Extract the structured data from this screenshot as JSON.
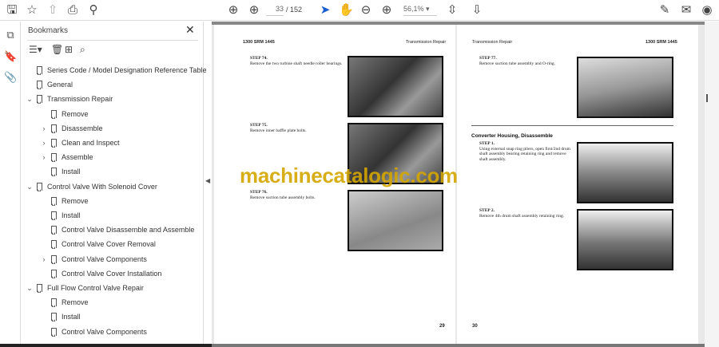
{
  "toolbar": {
    "page_current": "33",
    "page_total": "/ 152",
    "zoom": "56,1%"
  },
  "bookmarks": {
    "title": "Bookmarks",
    "items": [
      {
        "label": "Series Code / Model Designation Reference Table",
        "level": 0,
        "expander": ""
      },
      {
        "label": "General",
        "level": 0,
        "expander": ""
      },
      {
        "label": "Transmission Repair",
        "level": 0,
        "expander": "open"
      },
      {
        "label": "Remove",
        "level": 1,
        "expander": ""
      },
      {
        "label": "Disassemble",
        "level": 1,
        "expander": "closed"
      },
      {
        "label": "Clean and Inspect",
        "level": 1,
        "expander": "closed"
      },
      {
        "label": "Assemble",
        "level": 1,
        "expander": "closed"
      },
      {
        "label": "Install",
        "level": 1,
        "expander": ""
      },
      {
        "label": "Control Valve With Solenoid Cover",
        "level": 0,
        "expander": "open"
      },
      {
        "label": "Remove",
        "level": 1,
        "expander": ""
      },
      {
        "label": "Install",
        "level": 1,
        "expander": ""
      },
      {
        "label": "Control Valve Disassemble and Assemble",
        "level": 1,
        "expander": ""
      },
      {
        "label": "Control Valve Cover Removal",
        "level": 1,
        "expander": ""
      },
      {
        "label": "Control Valve Components",
        "level": 1,
        "expander": "closed"
      },
      {
        "label": "Control Valve Cover Installation",
        "level": 1,
        "expander": ""
      },
      {
        "label": "Full Flow Control Valve Repair",
        "level": 0,
        "expander": "open"
      },
      {
        "label": "Remove",
        "level": 1,
        "expander": ""
      },
      {
        "label": "Install",
        "level": 1,
        "expander": ""
      },
      {
        "label": "Control Valve Components",
        "level": 1,
        "expander": ""
      }
    ]
  },
  "left_page": {
    "header_left": "1300 SRM 1445",
    "header_right": "Transmission Repair",
    "page_number": "29",
    "steps": [
      {
        "title": "STEP 74.",
        "text": "Remove the two turbine shaft needle roller bearings."
      },
      {
        "title": "STEP 75.",
        "text": "Remove inner baffle plate bolts."
      },
      {
        "title": "STEP 76.",
        "text": "Remove suction tube assembly bolts."
      }
    ]
  },
  "right_page": {
    "header_left": "Transmission Repair",
    "header_right": "1300 SRM 1445",
    "page_number": "30",
    "section": "Converter Housing, Disassemble",
    "steps": [
      {
        "title": "STEP 77.",
        "text": "Remove suction tube assembly and O-ring."
      },
      {
        "title": "STEP 1.",
        "text": "Using external snap ring pliers, open first/2nd drum shaft assembly bearing retaining ring and remove shaft assembly."
      },
      {
        "title": "STEP 2.",
        "text": "Remove 4th drum shaft assembly retaining ring."
      }
    ]
  },
  "watermark": "machinecatalogic.com"
}
